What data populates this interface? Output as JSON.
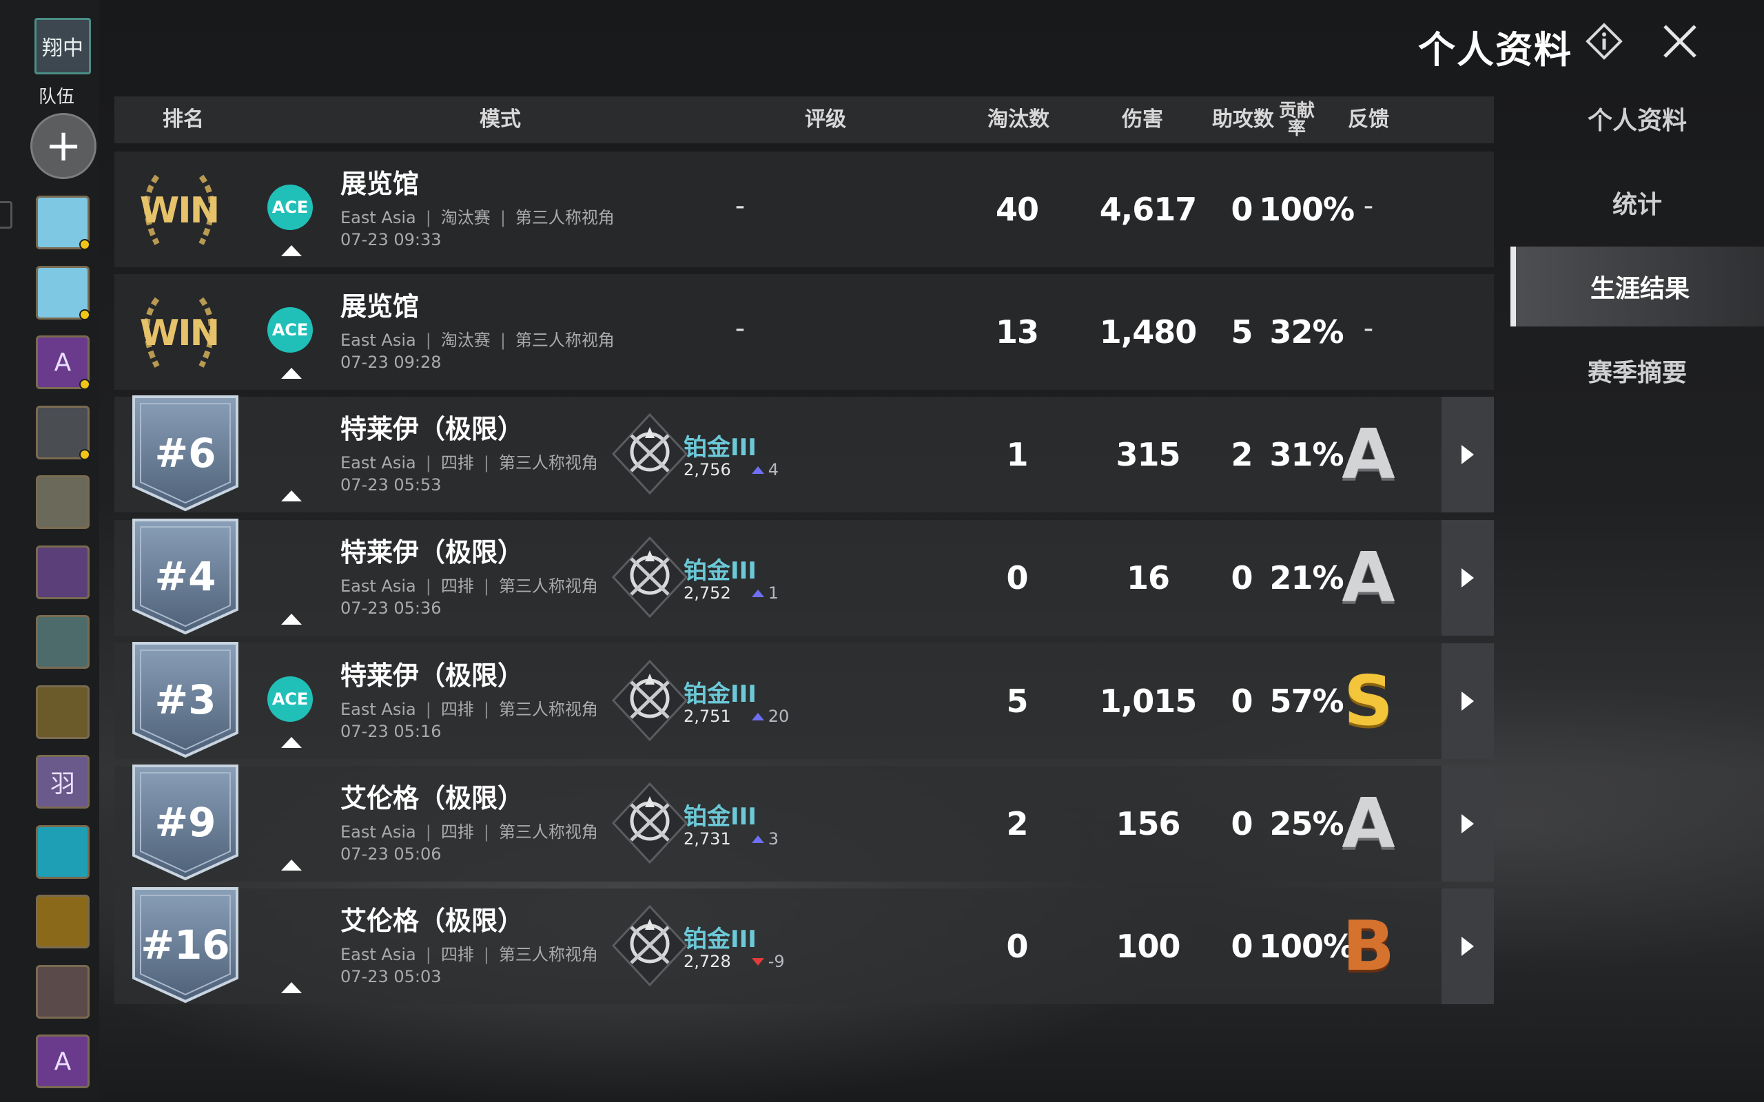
{
  "header": {
    "title": "个人资料"
  },
  "team": {
    "avatar_text": "翔中",
    "label": "队伍"
  },
  "friends": [
    {
      "glyph": "",
      "color": "#7ec8e3"
    },
    {
      "glyph": "",
      "color": "#7ec8e3"
    },
    {
      "glyph": "A",
      "color": "#6a3b8c"
    },
    {
      "glyph": "",
      "color": "#4a4d52"
    },
    {
      "glyph": "",
      "color": "#6b6a5a"
    },
    {
      "glyph": "",
      "color": "#5a3f78"
    },
    {
      "glyph": "",
      "color": "#4d6b6a"
    },
    {
      "glyph": "",
      "color": "#6b5a2a"
    },
    {
      "glyph": "羽",
      "color": "#6a5a8c"
    },
    {
      "glyph": "",
      "color": "#1f9fb5"
    },
    {
      "glyph": "",
      "color": "#8a6a1a"
    },
    {
      "glyph": "",
      "color": "#5a4a4a"
    },
    {
      "glyph": "A",
      "color": "#6a3b8c"
    }
  ],
  "nav": {
    "items": [
      {
        "label": "个人资料"
      },
      {
        "label": "统计"
      },
      {
        "label": "生涯结果",
        "active": true
      },
      {
        "label": "赛季摘要"
      }
    ]
  },
  "table": {
    "headers": {
      "rank": "排名",
      "mode": "模式",
      "rating": "评级",
      "kills": "淘汰数",
      "damage": "伤害",
      "assists": "助攻数",
      "contribution": "贡献率",
      "feedback": "反馈"
    },
    "win_text": "WIN",
    "ace_text": "ACE",
    "dash": "-",
    "rows": [
      {
        "rank": "WIN",
        "ace": true,
        "mode": "展览馆",
        "region": "East Asia",
        "type": "淘汰赛",
        "view": "第三人称视角",
        "date": "07-23 09:33",
        "tier": "",
        "points": "",
        "delta": "",
        "kills": "40",
        "damage": "4,617",
        "assists": "0",
        "contribution": "100%",
        "grade": ""
      },
      {
        "rank": "WIN",
        "ace": true,
        "mode": "展览馆",
        "region": "East Asia",
        "type": "淘汰赛",
        "view": "第三人称视角",
        "date": "07-23 09:28",
        "tier": "",
        "points": "",
        "delta": "",
        "kills": "13",
        "damage": "1,480",
        "assists": "5",
        "contribution": "32%",
        "grade": ""
      },
      {
        "rank": "#6",
        "ace": false,
        "mode": "特莱伊（极限）",
        "region": "East Asia",
        "type": "四排",
        "view": "第三人称视角",
        "date": "07-23 05:53",
        "tier": "铂金III",
        "points": "2,756",
        "delta": "4",
        "trend": "up",
        "kills": "1",
        "damage": "315",
        "assists": "2",
        "contribution": "31%",
        "grade": "A"
      },
      {
        "rank": "#4",
        "ace": false,
        "mode": "特莱伊（极限）",
        "region": "East Asia",
        "type": "四排",
        "view": "第三人称视角",
        "date": "07-23 05:36",
        "tier": "铂金III",
        "points": "2,752",
        "delta": "1",
        "trend": "up",
        "kills": "0",
        "damage": "16",
        "assists": "0",
        "contribution": "21%",
        "grade": "A"
      },
      {
        "rank": "#3",
        "ace": true,
        "mode": "特莱伊（极限）",
        "region": "East Asia",
        "type": "四排",
        "view": "第三人称视角",
        "date": "07-23 05:16",
        "tier": "铂金III",
        "points": "2,751",
        "delta": "20",
        "trend": "up",
        "kills": "5",
        "damage": "1,015",
        "assists": "0",
        "contribution": "57%",
        "grade": "S"
      },
      {
        "rank": "#9",
        "ace": false,
        "mode": "艾伦格（极限）",
        "region": "East Asia",
        "type": "四排",
        "view": "第三人称视角",
        "date": "07-23 05:06",
        "tier": "铂金III",
        "points": "2,731",
        "delta": "3",
        "trend": "up",
        "kills": "2",
        "damage": "156",
        "assists": "0",
        "contribution": "25%",
        "grade": "A"
      },
      {
        "rank": "#16",
        "ace": false,
        "mode": "艾伦格（极限）",
        "region": "East Asia",
        "type": "四排",
        "view": "第三人称视角",
        "date": "07-23 05:03",
        "tier": "铂金III",
        "points": "2,728",
        "delta": "-9",
        "trend": "down",
        "kills": "0",
        "damage": "100",
        "assists": "0",
        "contribution": "100%",
        "grade": "B"
      }
    ]
  },
  "colors": {
    "ace": "#20c0b8",
    "tier": "#6bc9d8",
    "win_gold": "#e6c36a",
    "trend_up": "#6f6ff5",
    "trend_down": "#e23b3b",
    "grade_A": "#d2d4d6",
    "grade_S": "#f2c53a",
    "grade_B": "#d4722e"
  }
}
